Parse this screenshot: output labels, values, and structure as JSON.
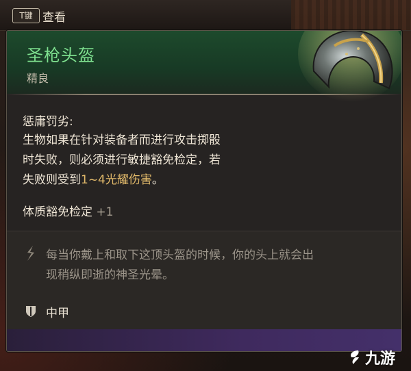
{
  "keyhint": {
    "key": "T键",
    "label": "查看"
  },
  "item": {
    "name": "圣枪头盔",
    "rarity": "精良",
    "ability_title": "惩庸罚劣:",
    "desc_line1": "生物如果在针对装备者而进行攻击掷骰",
    "desc_line2": "时失败，则必须进行敏捷豁免检定，若",
    "desc_line3_pre": "失败则受到",
    "desc_line3_hl": "1~4光耀伤害",
    "desc_line3_post": "。",
    "bonus_label": "体质豁免检定",
    "bonus_value": "+1",
    "flavor_line1": "每当你戴上和取下这顶头盔的时候，你的头上就会出",
    "flavor_line2": "现稍纵即逝的神圣光晕。",
    "armor_type": "中甲"
  },
  "icons": {
    "helmet": "helmet-icon",
    "flavor": "feather-icon",
    "armor": "shield-icon"
  },
  "colors": {
    "name": "#7ee08f",
    "highlight": "#e1b96a",
    "header_bg": "#1d4a2c",
    "footer_bar": "#3f2a5e"
  },
  "watermark": {
    "text": "九游"
  }
}
